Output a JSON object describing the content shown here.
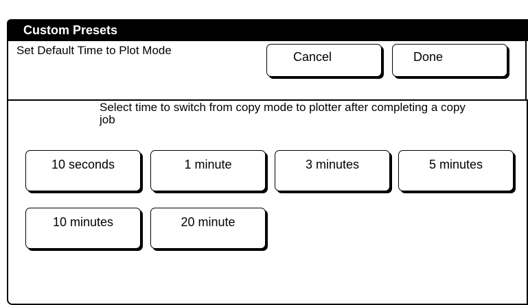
{
  "window": {
    "title": "Custom Presets"
  },
  "header": {
    "mode_label": "Set Default Time to Plot Mode",
    "cancel_label": "Cancel",
    "done_label": "Done"
  },
  "instruction": "Select time to switch from copy mode to plotter after completing a copy job",
  "options": [
    {
      "label": "10 seconds"
    },
    {
      "label": "1 minute"
    },
    {
      "label": "3 minutes"
    },
    {
      "label": "5 minutes"
    },
    {
      "label": "10 minutes"
    },
    {
      "label": "20 minute"
    }
  ]
}
